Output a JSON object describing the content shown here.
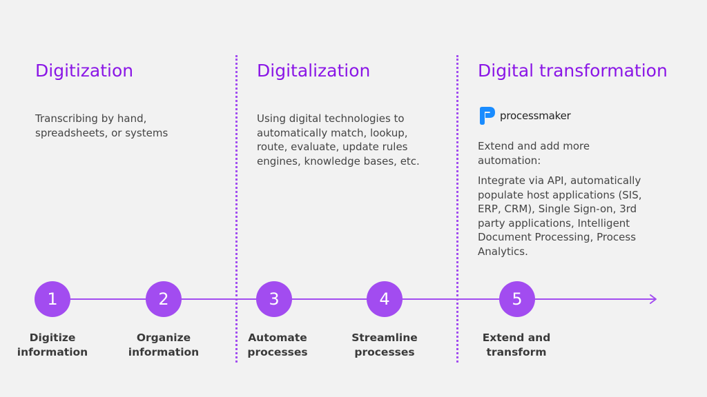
{
  "colors": {
    "accent": "#8a16e6",
    "timeline": "#a24cf0",
    "circle_fill": "#a24cf0",
    "body_text": "#444444",
    "label_text": "#3a3a3a",
    "background": "#f2f2f2",
    "logo_blue": "#1a8cff"
  },
  "columns": [
    {
      "title": "Digitization",
      "description_lines": [
        "Transcribing by hand,",
        "spreadsheets, or systems"
      ]
    },
    {
      "title": "Digitalization",
      "description_lines": [
        "Using digital technologies to",
        "automatically match, lookup,",
        "route, evaluate, update rules",
        "engines, knowledge bases, etc."
      ]
    },
    {
      "title": "Digital transformation",
      "logo": {
        "icon": "processmaker-logo-icon",
        "text": "processmaker"
      },
      "description_intro_lines": [
        "Extend and add more",
        "automation:"
      ],
      "description_lines": [
        "Integrate via API, automatically",
        "populate host applications (SIS,",
        "ERP, CRM), Single Sign-on, 3rd",
        "party applications, Intelligent",
        "Document Processing, Process",
        "Analytics."
      ]
    }
  ],
  "steps": [
    {
      "number": "1",
      "label_lines": [
        "Digitize",
        "information"
      ]
    },
    {
      "number": "2",
      "label_lines": [
        "Organize",
        "information"
      ]
    },
    {
      "number": "3",
      "label_lines": [
        "Automate",
        "processes"
      ]
    },
    {
      "number": "4",
      "label_lines": [
        "Streamline",
        "processes"
      ]
    },
    {
      "number": "5",
      "label_lines": [
        "Extend and",
        "transform"
      ]
    }
  ],
  "timeline": {
    "end_icon": "arrow-right-icon"
  }
}
